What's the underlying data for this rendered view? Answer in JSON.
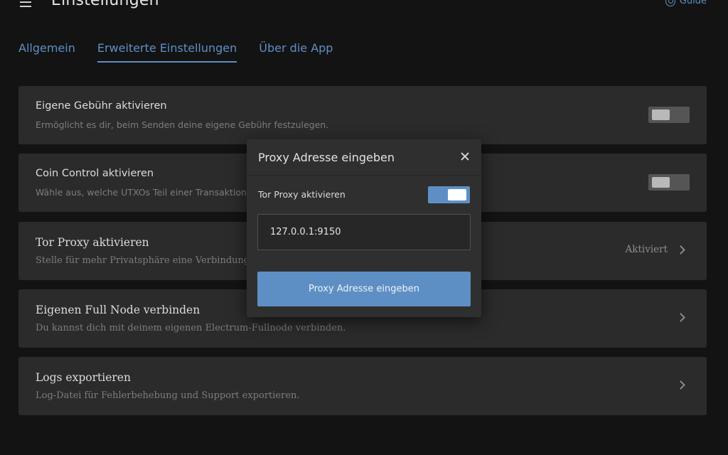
{
  "header": {
    "title": "Einstellungen",
    "guide_label": "Guide"
  },
  "tabs": [
    {
      "label": "Allgemein"
    },
    {
      "label": "Erweiterte Einstellungen"
    },
    {
      "label": "Über die App"
    }
  ],
  "settings": [
    {
      "title": "Eigene Gebühr aktivieren",
      "description": "Ermöglicht es dir, beim Senden deine eigene Gebühr festzulegen.",
      "control": "toggle",
      "enabled": false
    },
    {
      "title": "Coin Control aktivieren",
      "description": "Wähle aus, welche UTXOs Teil einer Transaktion s",
      "control": "toggle",
      "enabled": false
    },
    {
      "title": "Tor Proxy aktivieren",
      "description": "Stelle für mehr Privatsphäre eine Verbindung",
      "control": "link",
      "status": "Aktiviert"
    },
    {
      "title": "Eigenen Full Node verbinden",
      "description": "Du kannst dich mit deinem eigenen Electrum-Fullnode verbinden.",
      "control": "link"
    },
    {
      "title": "Logs exportieren",
      "description": "Log-Datei für Fehlerbehebung und Support exportieren.",
      "control": "link"
    }
  ],
  "dialog": {
    "title": "Proxy Adresse eingeben",
    "tor_label": "Tor Proxy aktivieren",
    "tor_enabled": true,
    "proxy_value": "127.0.0.1:9150",
    "submit_label": "Proxy Adresse eingeben"
  },
  "colors": {
    "accent": "#5e8fc4",
    "background": "#131313",
    "card": "#2b2b2b"
  }
}
